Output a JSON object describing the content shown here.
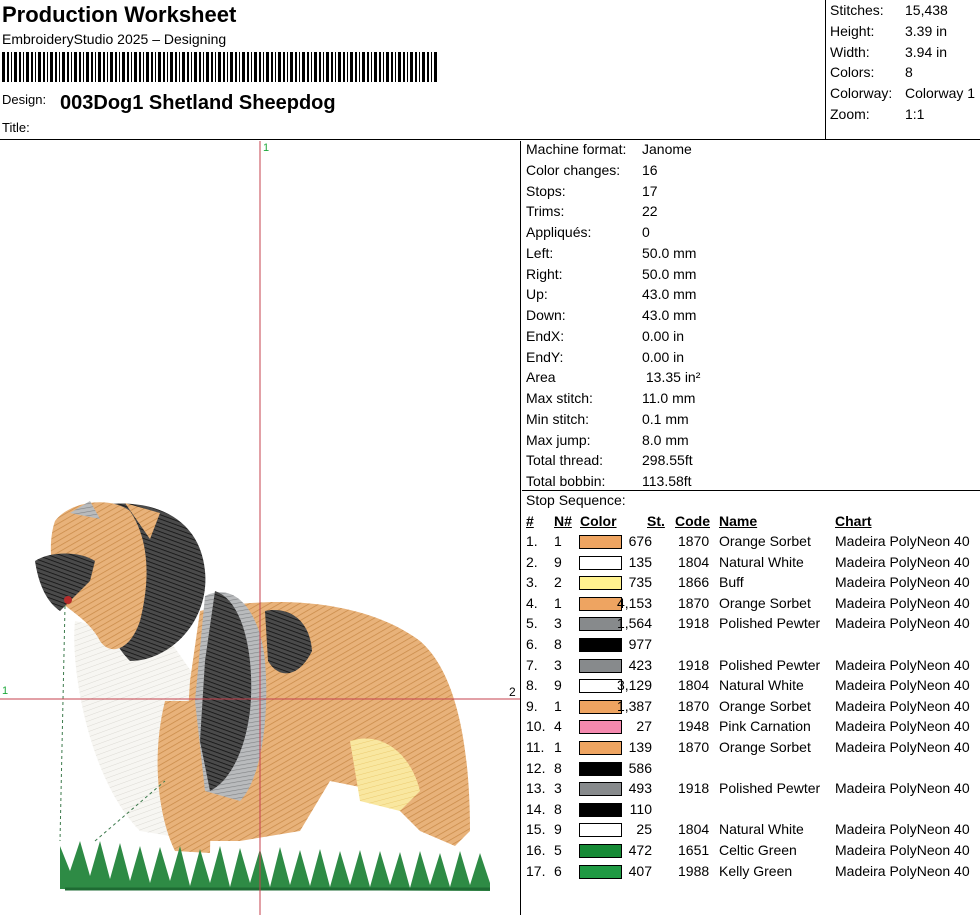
{
  "header": {
    "title": "Production Worksheet",
    "subtitle": "EmbroideryStudio 2025 – Designing",
    "design_label": "Design:",
    "design_name": "003Dog1 Shetland Sheepdog",
    "title_label": "Title:"
  },
  "summary": [
    {
      "label": "Stitches:",
      "value": "15,438"
    },
    {
      "label": "Height:",
      "value": "3.39 in"
    },
    {
      "label": "Width:",
      "value": "3.94 in"
    },
    {
      "label": "Colors:",
      "value": "8"
    },
    {
      "label": "Colorway:",
      "value": "Colorway 1"
    },
    {
      "label": "Zoom:",
      "value": "1:1"
    }
  ],
  "canvas": {
    "marker_top": "1",
    "marker_left": "1",
    "marker_right": "2"
  },
  "properties": [
    {
      "label": "Machine format:",
      "value": "Janome"
    },
    {
      "label": "Color changes:",
      "value": "16"
    },
    {
      "label": "Stops:",
      "value": "17"
    },
    {
      "label": "Trims:",
      "value": "22"
    },
    {
      "label": "Appliqués:",
      "value": "0"
    },
    {
      "label": "Left:",
      "value": "50.0 mm"
    },
    {
      "label": "Right:",
      "value": "50.0 mm"
    },
    {
      "label": "Up:",
      "value": "43.0 mm"
    },
    {
      "label": "Down:",
      "value": "43.0 mm"
    },
    {
      "label": "EndX:",
      "value": "0.00 in"
    },
    {
      "label": "EndY:",
      "value": "0.00 in"
    },
    {
      "label": "Area",
      "value": " 13.35 in²"
    },
    {
      "label": "Max stitch:",
      "value": "11.0 mm"
    },
    {
      "label": "Min stitch:",
      "value": "0.1 mm"
    },
    {
      "label": "Max jump:",
      "value": "8.0 mm"
    },
    {
      "label": "Total thread:",
      "value": "298.55ft"
    },
    {
      "label": "Total bobbin:",
      "value": "113.58ft"
    }
  ],
  "stop_sequence": {
    "title": "Stop Sequence:",
    "headers": {
      "idx": "#",
      "n": "N#",
      "color": "Color",
      "st": "St.",
      "code": "Code",
      "name": "Name",
      "chart": "Chart"
    },
    "rows": [
      {
        "idx": "1.",
        "n": "1",
        "color": "#EEA461",
        "st": "676",
        "code": "1870",
        "name": "Orange Sorbet",
        "chart": "Madeira PolyNeon 40"
      },
      {
        "idx": "2.",
        "n": "9",
        "color": "#FFFFFF",
        "st": "135",
        "code": "1804",
        "name": "Natural White",
        "chart": "Madeira PolyNeon 40"
      },
      {
        "idx": "3.",
        "n": "2",
        "color": "#FFF28F",
        "st": "735",
        "code": "1866",
        "name": "Buff",
        "chart": "Madeira PolyNeon 40"
      },
      {
        "idx": "4.",
        "n": "1",
        "color": "#EEA461",
        "st": "4,153",
        "code": "1870",
        "name": "Orange Sorbet",
        "chart": "Madeira PolyNeon 40"
      },
      {
        "idx": "5.",
        "n": "3",
        "color": "#878A8C",
        "st": "1,564",
        "code": "1918",
        "name": "Polished Pewter",
        "chart": "Madeira PolyNeon 40"
      },
      {
        "idx": "6.",
        "n": "8",
        "color": "#000000",
        "st": "977",
        "code": "",
        "name": "",
        "chart": ""
      },
      {
        "idx": "7.",
        "n": "3",
        "color": "#878A8C",
        "st": "423",
        "code": "1918",
        "name": "Polished Pewter",
        "chart": "Madeira PolyNeon 40"
      },
      {
        "idx": "8.",
        "n": "9",
        "color": "#FFFFFF",
        "st": "3,129",
        "code": "1804",
        "name": "Natural White",
        "chart": "Madeira PolyNeon 40"
      },
      {
        "idx": "9.",
        "n": "1",
        "color": "#EEA461",
        "st": "1,387",
        "code": "1870",
        "name": "Orange Sorbet",
        "chart": "Madeira PolyNeon 40"
      },
      {
        "idx": "10.",
        "n": "4",
        "color": "#F489AE",
        "st": "27",
        "code": "1948",
        "name": "Pink Carnation",
        "chart": "Madeira PolyNeon 40"
      },
      {
        "idx": "11.",
        "n": "1",
        "color": "#EEA461",
        "st": "139",
        "code": "1870",
        "name": "Orange Sorbet",
        "chart": "Madeira PolyNeon 40"
      },
      {
        "idx": "12.",
        "n": "8",
        "color": "#000000",
        "st": "586",
        "code": "",
        "name": "",
        "chart": ""
      },
      {
        "idx": "13.",
        "n": "3",
        "color": "#878A8C",
        "st": "493",
        "code": "1918",
        "name": "Polished Pewter",
        "chart": "Madeira PolyNeon 40"
      },
      {
        "idx": "14.",
        "n": "8",
        "color": "#000000",
        "st": "110",
        "code": "",
        "name": "",
        "chart": ""
      },
      {
        "idx": "15.",
        "n": "9",
        "color": "#FFFFFF",
        "st": "25",
        "code": "1804",
        "name": "Natural White",
        "chart": "Madeira PolyNeon 40"
      },
      {
        "idx": "16.",
        "n": "5",
        "color": "#168A35",
        "st": "472",
        "code": "1651",
        "name": "Celtic Green",
        "chart": "Madeira PolyNeon 40"
      },
      {
        "idx": "17.",
        "n": "6",
        "color": "#1F9A43",
        "st": "407",
        "code": "1988",
        "name": "Kelly Green",
        "chart": "Madeira PolyNeon 40"
      }
    ]
  }
}
